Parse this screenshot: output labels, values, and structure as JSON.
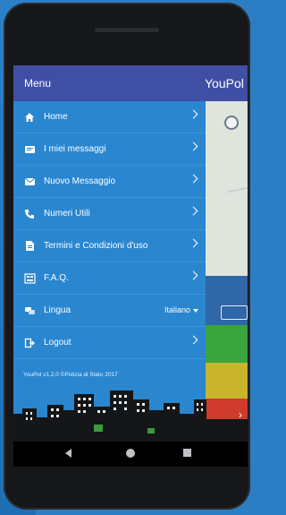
{
  "app": {
    "title": "YouPol"
  },
  "drawer": {
    "header": "Menu",
    "items": [
      {
        "label": "Home",
        "icon": "home-icon"
      },
      {
        "label": "I miei messaggi",
        "icon": "messages-icon"
      },
      {
        "label": "Nuovo Messaggio",
        "icon": "new-message-icon"
      },
      {
        "label": "Numeri Utili",
        "icon": "phone-icon"
      },
      {
        "label": "Termini e Condizioni d'uso",
        "icon": "document-icon"
      },
      {
        "label": "F.A.Q.",
        "icon": "faq-icon"
      },
      {
        "label": "Lingua",
        "icon": "language-icon",
        "value": "Italiano"
      },
      {
        "label": "Logout",
        "icon": "logout-icon"
      }
    ],
    "footer": "YouPol v1.2.0 ©Polizia di Stato 2017"
  },
  "colors": {
    "drawer_bg": "#2a86cf",
    "header_bg": "#3f4fa6",
    "status_green": "#39a53c",
    "status_yellow": "#c9b52c",
    "status_red": "#cf3b2d"
  }
}
